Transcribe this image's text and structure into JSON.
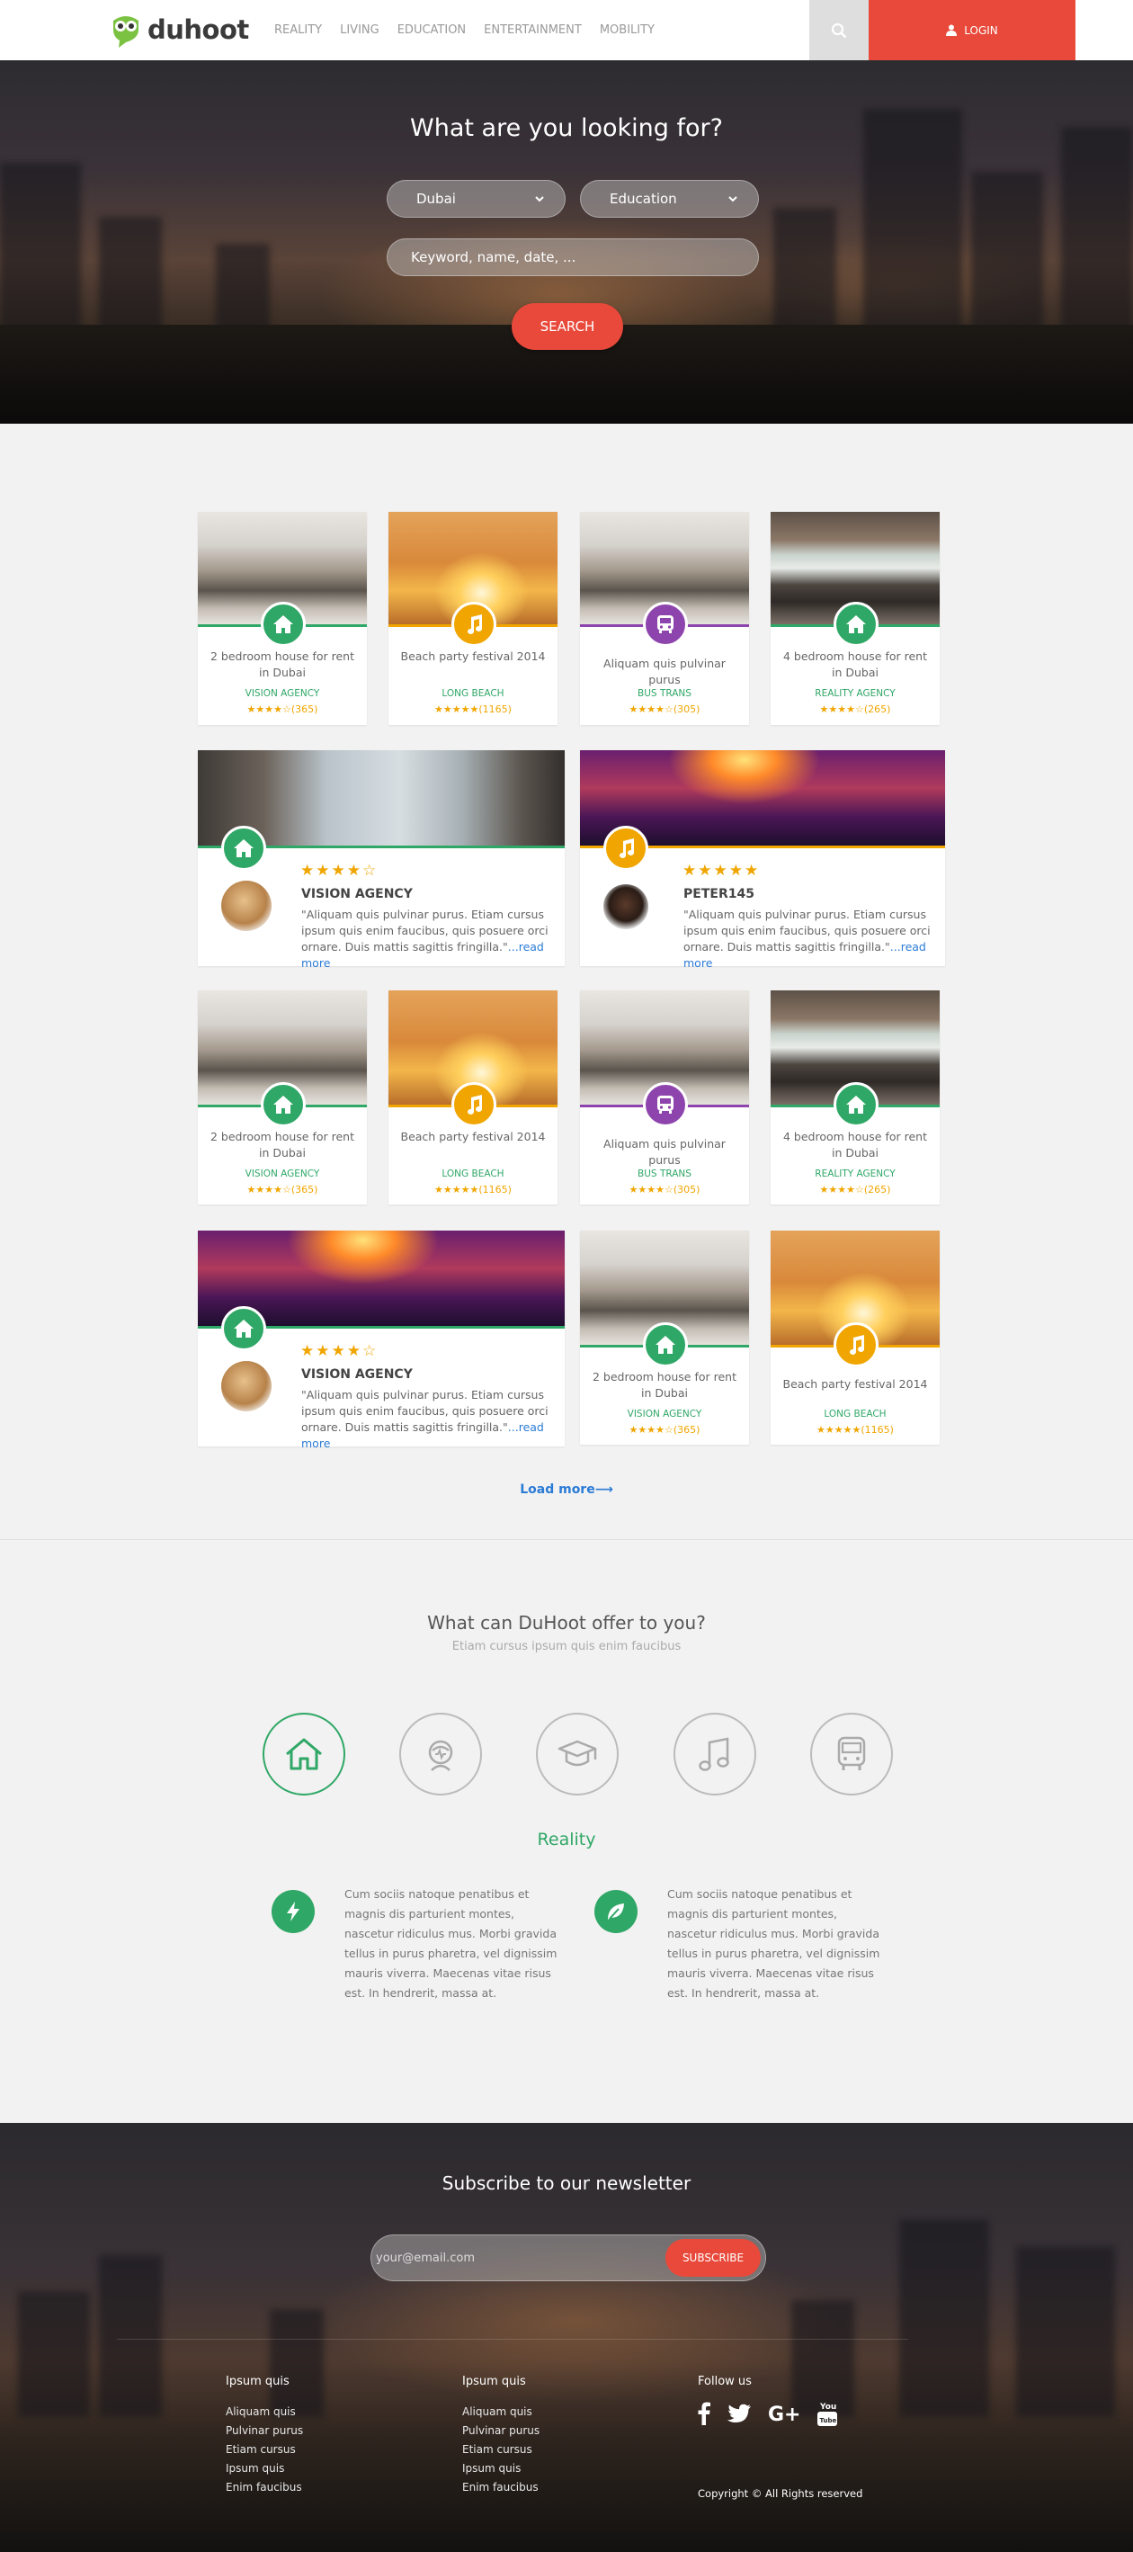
{
  "nav": {
    "brand": "duhoot",
    "links": [
      "REALITY",
      "LIVING",
      "EDUCATION",
      "ENTERTAINMENT",
      "MOBILITY"
    ],
    "login": "LOGIN",
    "icons": {
      "search": "search-icon",
      "login": "user-icon"
    }
  },
  "hero": {
    "title": "What are you looking for?",
    "location": "Dubai",
    "category": "Education",
    "keyword_placeholder": "Keyword, name, date, ...",
    "search_button": "SEARCH"
  },
  "colors": {
    "accent": "#e8493a",
    "green": "#2fa766",
    "orange": "#f0a500",
    "purple": "#8e44ad",
    "link": "#2b7bd6"
  },
  "row1": [
    {
      "title": "2 bedroom house for rent in Dubai",
      "agency": "VISION AGENCY",
      "stars": "★★★★☆",
      "count": "(365)",
      "icon": "home-icon",
      "color": "green"
    },
    {
      "title": "Beach party festival 2014",
      "agency": "LONG BEACH",
      "stars": "★★★★★",
      "count": "(1165)",
      "icon": "music-icon",
      "color": "orange"
    },
    {
      "title": "Aliquam quis pulvinar purus",
      "agency": "BUS TRANS",
      "stars": "★★★★☆",
      "count": "(305)",
      "icon": "bus-icon",
      "color": "purple"
    },
    {
      "title": "4 bedroom house for rent in Dubai",
      "agency": "REALITY AGENCY",
      "stars": "★★★★☆",
      "count": "(265)",
      "icon": "home-icon",
      "color": "green"
    }
  ],
  "wide1": [
    {
      "stars": "★★★★☆",
      "name": "VISION AGENCY",
      "text": "\"Aliquam quis pulvinar purus. Etiam cursus ipsum quis enim faucibus, quis posuere orci ornare. Duis mattis sagittis fringilla.\"",
      "more": "...read more",
      "icon": "home-icon"
    },
    {
      "stars": "★★★★★",
      "name": "PETER145",
      "text": "\"Aliquam quis pulvinar purus. Etiam cursus ipsum quis enim faucibus, quis posuere orci ornare. Duis mattis sagittis fringilla.\"",
      "more": "...read more",
      "icon": "music-icon"
    }
  ],
  "row2": [
    {
      "title": "2 bedroom house for rent in Dubai",
      "agency": "VISION AGENCY",
      "stars": "★★★★☆",
      "count": "(365)"
    },
    {
      "title": "Beach party festival 2014",
      "agency": "LONG BEACH",
      "stars": "★★★★★",
      "count": "(1165)"
    },
    {
      "title": "Aliquam quis pulvinar purus",
      "agency": "BUS TRANS",
      "stars": "★★★★☆",
      "count": "(305)"
    },
    {
      "title": "4 bedroom house for rent in Dubai",
      "agency": "REALITY AGENCY",
      "stars": "★★★★☆",
      "count": "(265)"
    }
  ],
  "wide2": {
    "stars": "★★★★☆",
    "name": "VISION AGENCY",
    "text": "\"Aliquam quis pulvinar purus. Etiam cursus ipsum quis enim faucibus, quis posuere orci ornare. Duis mattis sagittis fringilla.\"",
    "more": "...read more"
  },
  "row3": [
    {
      "title": "2 bedroom house for rent in Dubai",
      "agency": "VISION AGENCY",
      "stars": "★★★★☆",
      "count": "(365)"
    },
    {
      "title": "Beach party festival 2014",
      "agency": "LONG BEACH",
      "stars": "★★★★★",
      "count": "(1165)"
    }
  ],
  "load_more": "Load more⟶",
  "offer": {
    "title": "What can DuHoot offer to you?",
    "subtitle": "Etiam cursus ipsum quis enim faucibus",
    "categories": [
      "home-icon",
      "living-icon",
      "education-icon",
      "music-icon",
      "bus-icon"
    ],
    "active_label": "Reality",
    "features": [
      {
        "icon": "bolt-icon",
        "text": "Cum sociis natoque penatibus et magnis dis parturient montes, nascetur ridiculus mus. Morbi gravida tellus in purus pharetra, vel dignissim mauris viverra. Maecenas vitae risus est. In hendrerit, massa at."
      },
      {
        "icon": "leaf-icon",
        "text": "Cum sociis natoque penatibus et magnis dis parturient montes, nascetur ridiculus mus. Morbi gravida tellus in purus pharetra, vel dignissim mauris viverra. Maecenas vitae risus est. In hendrerit, massa at."
      }
    ]
  },
  "footer": {
    "newsletter_title": "Subscribe to our newsletter",
    "email_placeholder": "your@email.com",
    "subscribe": "SUBSCRIBE",
    "col1": {
      "head": "Ipsum quis",
      "links": [
        "Aliquam quis",
        "Pulvinar purus",
        "Etiam cursus",
        "Ipsum quis",
        "Enim faucibus"
      ]
    },
    "col2": {
      "head": "Ipsum quis",
      "links": [
        "Aliquam quis",
        "Pulvinar purus",
        "Etiam cursus",
        "Ipsum quis",
        "Enim faucibus"
      ]
    },
    "follow": "Follow us",
    "social": [
      "facebook-icon",
      "twitter-icon",
      "google-plus-icon",
      "youtube-icon"
    ],
    "youtube_text": "You Tube",
    "copyright": "Copyright © All Rights reserved"
  }
}
